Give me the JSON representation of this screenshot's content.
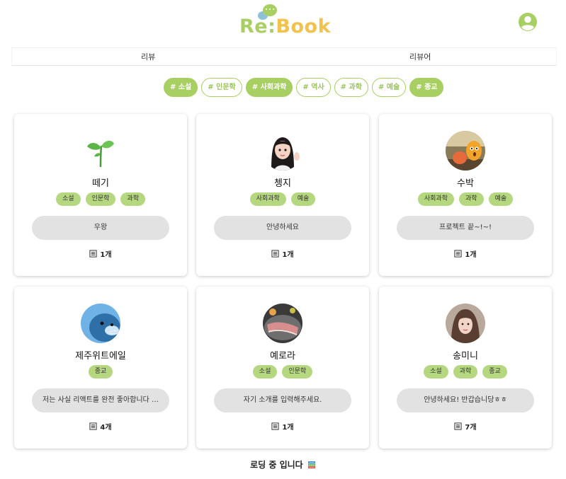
{
  "header": {
    "logo": {
      "re": "Re",
      "colon": ":",
      "book": "Book"
    },
    "profile_icon": "account-circle-icon",
    "colors": {
      "brand_green": "#a8cf62",
      "brand_yellow": "#f2c14e",
      "bubble_blue": "#8dc2d6"
    }
  },
  "tabs": [
    {
      "label": "리뷰"
    },
    {
      "label": "리뷰어"
    }
  ],
  "genres": [
    {
      "label": "# 소설",
      "active": true
    },
    {
      "label": "# 인문학",
      "active": false
    },
    {
      "label": "# 사회과학",
      "active": true
    },
    {
      "label": "# 역사",
      "active": false
    },
    {
      "label": "# 과학",
      "active": false
    },
    {
      "label": "# 예술",
      "active": false
    },
    {
      "label": "# 종교",
      "active": true
    }
  ],
  "reviewers": [
    {
      "name": "떼기",
      "avatar": "sprout-avatar",
      "tags": [
        "소설",
        "인문학",
        "과학"
      ],
      "intro": "우왕",
      "count": "1개"
    },
    {
      "name": "쳉지",
      "avatar": "girl-waving-avatar",
      "tags": [
        "사회과학",
        "예술"
      ],
      "intro": "안녕하세요",
      "count": "1개"
    },
    {
      "name": "수박",
      "avatar": "character-photo-avatar",
      "tags": [
        "사회과학",
        "과학",
        "예술"
      ],
      "intro": "프로젝트 끝~!~!",
      "count": "1개"
    },
    {
      "name": "제주위트에일",
      "avatar": "seal-avatar",
      "tags": [
        "종교"
      ],
      "intro": "저는 사실 리액트를 완전 좋아합니다 …",
      "count": "4개"
    },
    {
      "name": "예로라",
      "avatar": "food-photo-avatar",
      "tags": [
        "소설",
        "인문학"
      ],
      "intro": "자기 소개를 입력해주세요.",
      "count": "1개"
    },
    {
      "name": "송미니",
      "avatar": "person-photo-avatar",
      "tags": [
        "소설",
        "과학",
        "종교"
      ],
      "intro": "안녕하세요! 반갑습니당ㅎㅎ",
      "count": "7개"
    }
  ],
  "footer": {
    "loading_text": "로딩 중 입니다",
    "loading_icon": "books-icon"
  }
}
